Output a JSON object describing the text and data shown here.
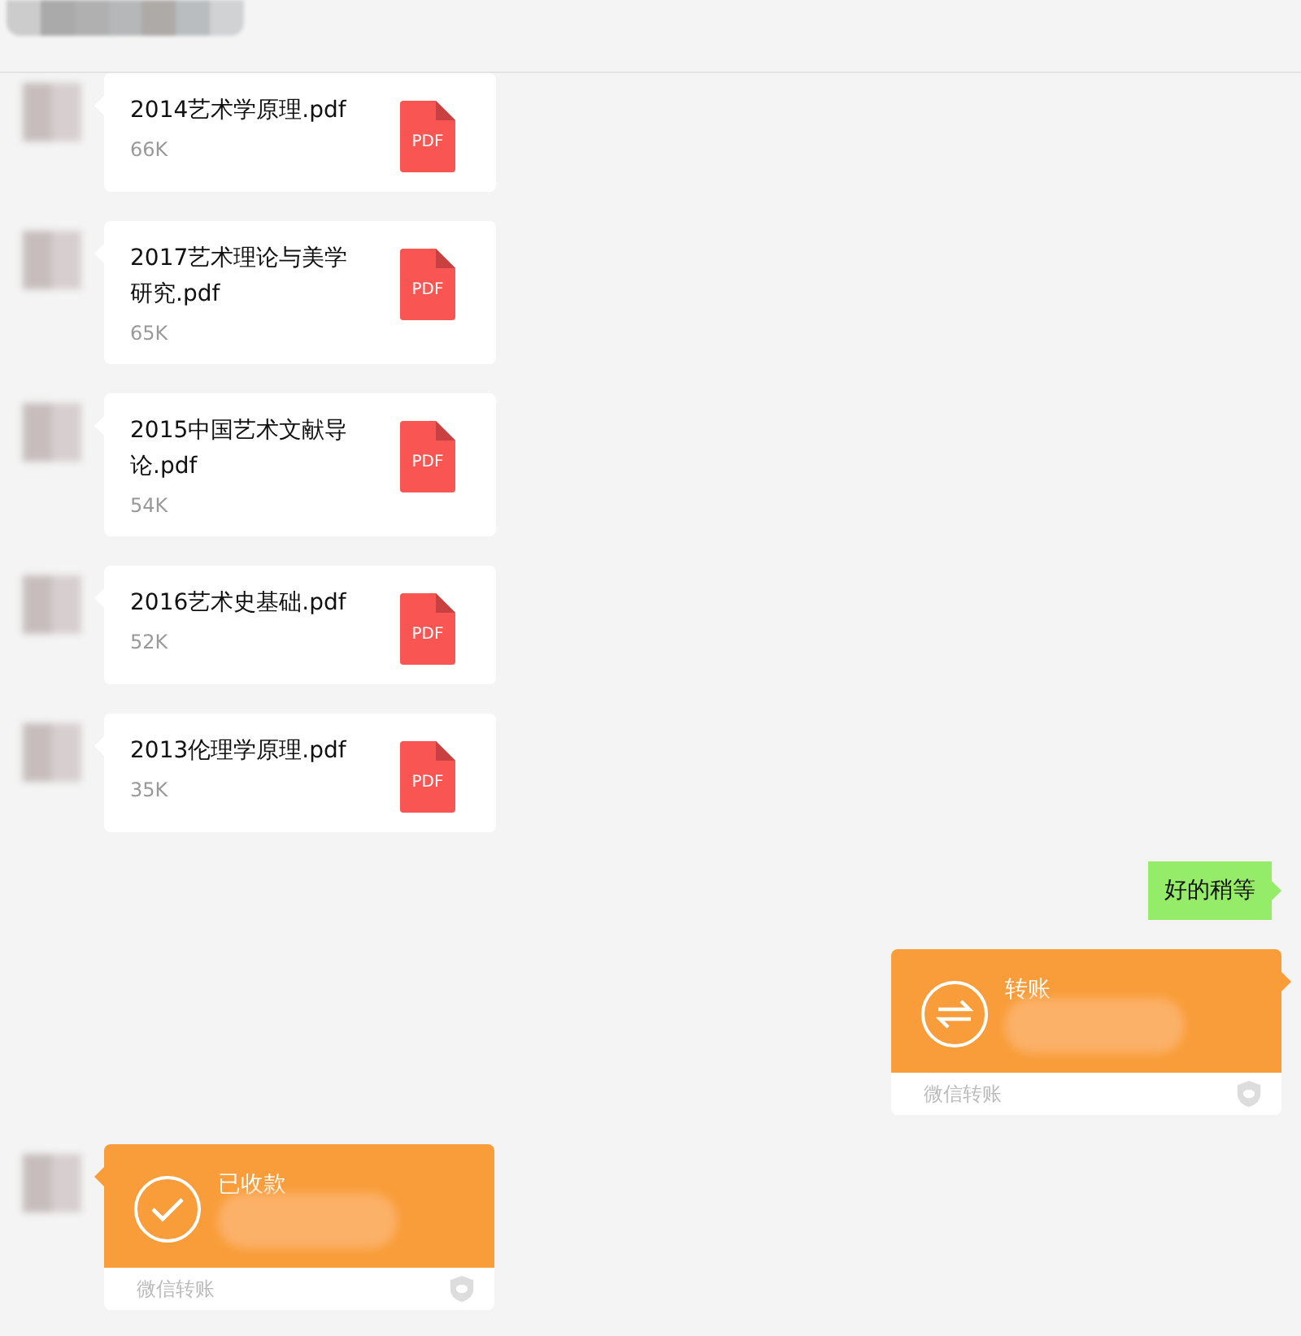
{
  "messages": [
    {
      "kind": "file",
      "name": "2014艺术学原理.pdf",
      "size": "66K",
      "badge": "PDF"
    },
    {
      "kind": "file",
      "name": "2017艺术理论与美学研究.pdf",
      "size": "65K",
      "badge": "PDF"
    },
    {
      "kind": "file",
      "name": "2015中国艺术文献导论.pdf",
      "size": "54K",
      "badge": "PDF"
    },
    {
      "kind": "file",
      "name": "2016艺术史基础.pdf",
      "size": "52K",
      "badge": "PDF"
    },
    {
      "kind": "file",
      "name": "2013伦理学原理.pdf",
      "size": "35K",
      "badge": "PDF"
    },
    {
      "kind": "text",
      "text": "好的稍等"
    },
    {
      "kind": "transfer",
      "title": "转账",
      "footer": "微信转账"
    },
    {
      "kind": "receipt",
      "title": "已收款",
      "footer": "微信转账"
    }
  ]
}
